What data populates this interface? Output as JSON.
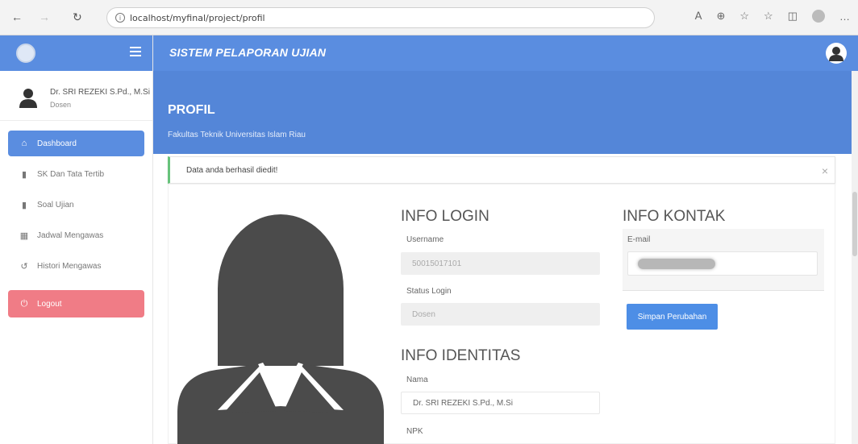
{
  "browser": {
    "url": "localhost/myfinal/project/profil",
    "back_icon": "arrow-left-icon",
    "forward_icon": "arrow-right-icon",
    "refresh_icon": "refresh-icon"
  },
  "sidebar": {
    "user": {
      "name": "Dr. SRI REZEKI S.Pd., M.Si",
      "role": "Dosen"
    },
    "items": [
      {
        "label": "Dashboard",
        "icon": "home-icon",
        "active": true
      },
      {
        "label": "SK Dan Tata Tertib",
        "icon": "file-icon",
        "active": false
      },
      {
        "label": "Soal Ujian",
        "icon": "file-icon",
        "active": false
      },
      {
        "label": "Jadwal Mengawas",
        "icon": "calendar-icon",
        "active": false
      },
      {
        "label": "Histori Mengawas",
        "icon": "history-icon",
        "active": false
      }
    ],
    "logout_label": "Logout"
  },
  "header": {
    "title": "SISTEM PELAPORAN UJIAN"
  },
  "hero": {
    "title": "PROFIL",
    "subtitle": "Fakultas Teknik Universitas Islam Riau"
  },
  "alert": {
    "text": "Data anda berhasil diedit!"
  },
  "login": {
    "title": "INFO LOGIN",
    "username_label": "Username",
    "username_value": "50015017101",
    "status_label": "Status Login",
    "status_value": "Dosen"
  },
  "identitas": {
    "title": "INFO IDENTITAS",
    "nama_label": "Nama",
    "nama_value": "Dr. SRI REZEKI S.Pd., M.Si",
    "npk_label": "NPK"
  },
  "kontak": {
    "title": "INFO KONTAK",
    "email_label": "E-mail",
    "save_label": "Simpan Perubahan"
  },
  "colors": {
    "primary": "#5a8de0",
    "logout": "#f07c86",
    "success": "#67c37b",
    "button": "#4d8ee6"
  }
}
